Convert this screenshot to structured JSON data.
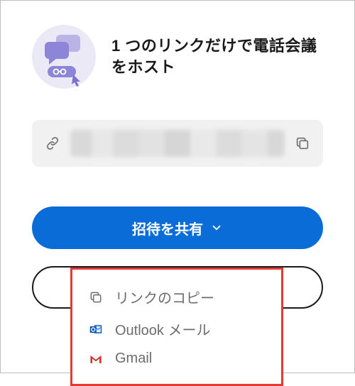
{
  "header": {
    "title": "1 つのリンクだけで電話会議をホスト"
  },
  "linkfield": {
    "value": ""
  },
  "buttons": {
    "share_invite": "招待を共有"
  },
  "menu": {
    "copy_link": "リンクのコピー",
    "outlook": "Outlook メール",
    "gmail": "Gmail"
  }
}
